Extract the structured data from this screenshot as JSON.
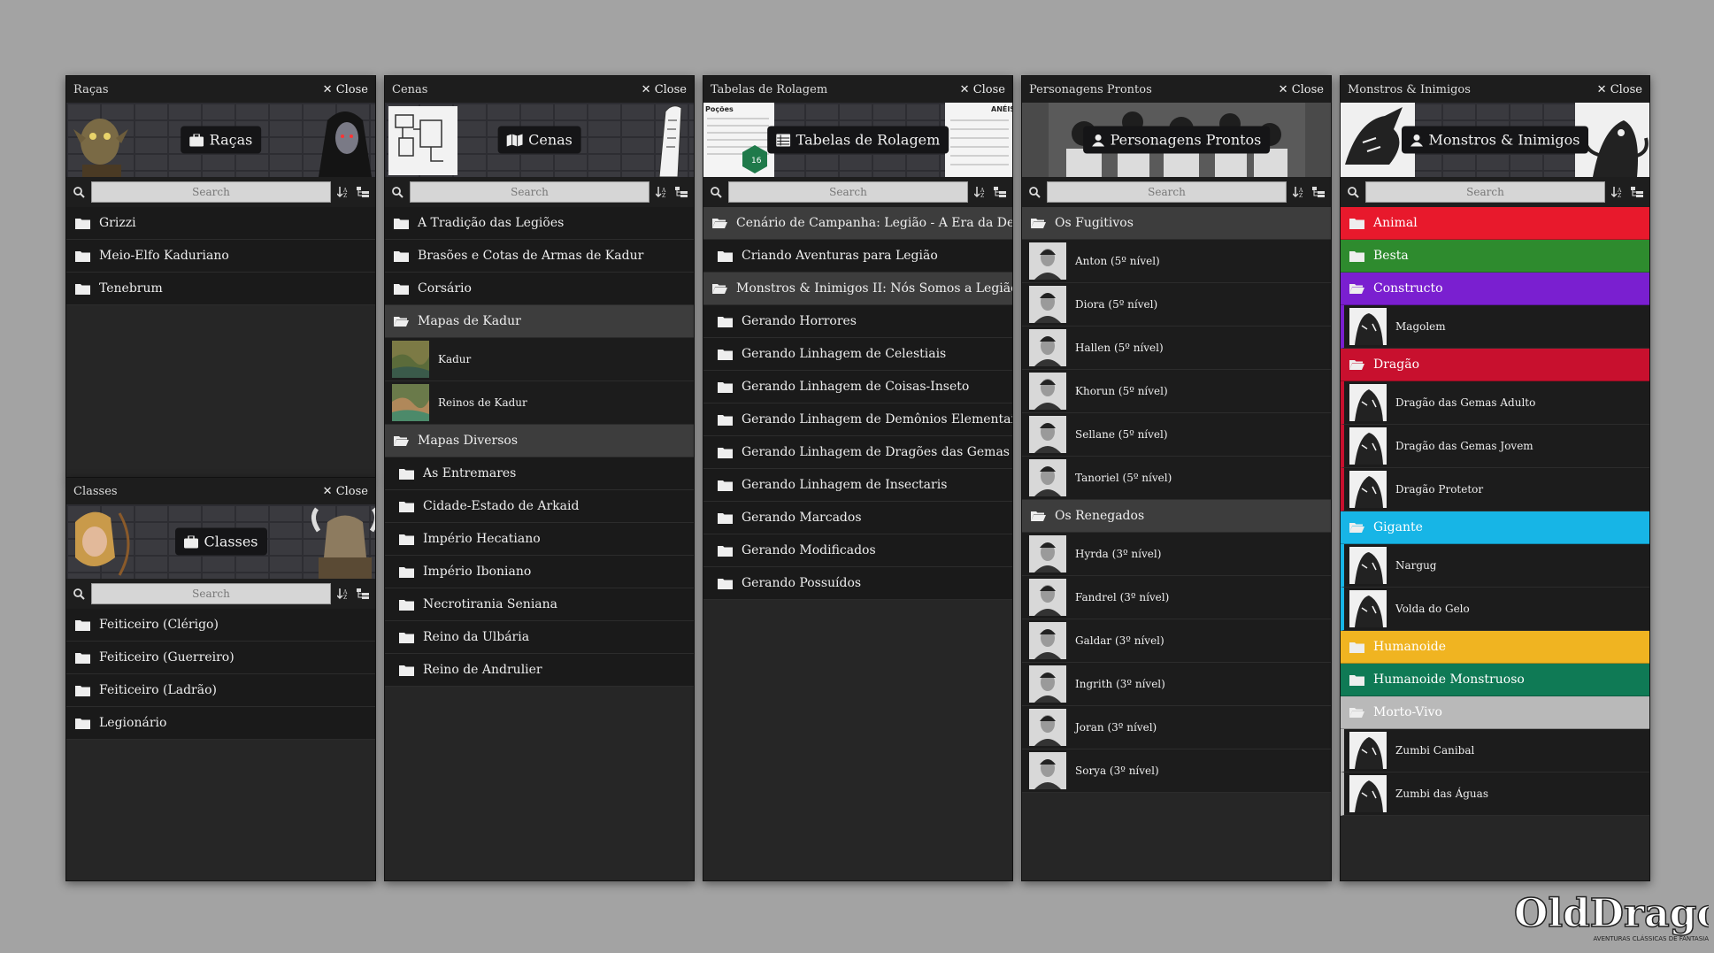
{
  "search_placeholder": "Search",
  "close_label": "Close",
  "racas": {
    "title": "Raças",
    "banner": "Raças",
    "items": [
      "Grizzi",
      "Meio-Elfo Kaduriano",
      "Tenebrum"
    ]
  },
  "classes": {
    "title": "Classes",
    "banner": "Classes",
    "items": [
      "Feiticeiro (Clérigo)",
      "Feiticeiro (Guerreiro)",
      "Feiticeiro (Ladrão)",
      "Legionário"
    ]
  },
  "cenas": {
    "title": "Cenas",
    "banner": "Cenas",
    "folders": [
      "A Tradição das Legiões",
      "Brasões e Cotas de Armas de Kadur",
      "Corsário"
    ],
    "mapas_kadur": {
      "label": "Mapas de Kadur",
      "items": [
        "Kadur",
        "Reinos de Kadur"
      ]
    },
    "mapas_diversos": {
      "label": "Mapas Diversos",
      "items": [
        "As Entremares",
        "Cidade-Estado de Arkaid",
        "Império Hecatiano",
        "Império Iboniano",
        "Necrotirania Seniana",
        "Reino da Ulbária",
        "Reino de Andrulier"
      ]
    }
  },
  "tabelas": {
    "title": "Tabelas de Rolagem",
    "banner": "Tabelas de Rolagem",
    "cenario": {
      "label": "Cenário de Campanha: Legião - A Era da Desola",
      "items": [
        "Criando Aventuras para Legião"
      ]
    },
    "monstros2": {
      "label": "Monstros & Inimigos II: Nós Somos a Legião",
      "items": [
        "Gerando Horrores",
        "Gerando Linhagem de Celestiais",
        "Gerando Linhagem de Coisas-Inseto",
        "Gerando Linhagem de Demônios Elementais",
        "Gerando Linhagem de Dragões das Gemas",
        "Gerando Linhagem de Insectaris",
        "Gerando Marcados",
        "Gerando Modificados",
        "Gerando Possuídos"
      ]
    },
    "art_left_text": "Poções",
    "art_right_text": "ANÉIS",
    "dice_value": "16"
  },
  "personagens": {
    "title": "Personagens Prontos",
    "banner": "Personagens Prontos",
    "fugitivos": {
      "label": "Os Fugitivos",
      "items": [
        "Anton (5º nível)",
        "Diora (5º nível)",
        "Hallen (5º nível)",
        "Khorun (5º nível)",
        "Sellane (5º nível)",
        "Tanoriel (5º nível)"
      ]
    },
    "renegados": {
      "label": "Os Renegados",
      "items": [
        "Hyrda (3º nível)",
        "Fandrel (3º nível)",
        "Galdar (3º nível)",
        "Ingrith (3º nível)",
        "Joran (3º nível)",
        "Sorya (3º nível)"
      ]
    }
  },
  "monstros": {
    "title": "Monstros & Inimigos",
    "banner": "Monstros & Inimigos",
    "categories": [
      {
        "label": "Animal",
        "color": "#e8192c",
        "open": false,
        "items": []
      },
      {
        "label": "Besta",
        "color": "#2e8b2e",
        "open": false,
        "items": []
      },
      {
        "label": "Constructo",
        "color": "#7a1fd0",
        "open": true,
        "items": [
          "Magolem"
        ]
      },
      {
        "label": "Dragão",
        "color": "#c8102e",
        "open": true,
        "items": [
          "Dragão das Gemas Adulto",
          "Dragão das Gemas Jovem",
          "Dragão Protetor"
        ]
      },
      {
        "label": "Gigante",
        "color": "#17b5e6",
        "open": true,
        "items": [
          "Nargug",
          "Volda do Gelo"
        ]
      },
      {
        "label": "Humanoide",
        "color": "#f0b421",
        "open": false,
        "items": []
      },
      {
        "label": "Humanoide Monstruoso",
        "color": "#0f7a55",
        "open": false,
        "items": []
      },
      {
        "label": "Morto-Vivo",
        "color": "#b9b9b9",
        "open": true,
        "items": [
          "Zumbi Canibal",
          "Zumbi das Águas"
        ]
      }
    ]
  },
  "logo": {
    "text": "OldDragon",
    "tagline": "AVENTURAS CLÁSSICAS DE FANTASIA"
  }
}
